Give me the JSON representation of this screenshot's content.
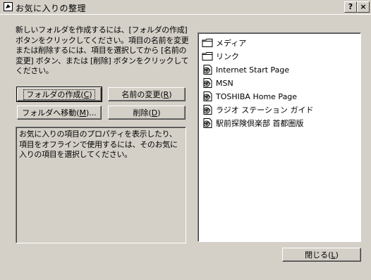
{
  "window": {
    "title": "お気に入りの整理",
    "help_label": "?",
    "close_label": "×"
  },
  "description": "新しいフォルダを作成するには、[フォルダの作成] ボタンをクリックしてください。項目の名前を変更または削除するには、項目を選択してから [名前の変更] ボタン、または [削除] ボタンをクリックしてください。",
  "buttons": {
    "create_folder": {
      "text": "フォルダの作成(",
      "key": "C",
      "end": ")"
    },
    "rename": {
      "text": "名前の変更(",
      "key": "R",
      "end": ")"
    },
    "move_to_folder": {
      "text": "フォルダへ移動(",
      "key": "M",
      "end": ")..."
    },
    "delete": {
      "text": "削除(",
      "key": "D",
      "end": ")"
    },
    "close": {
      "text": "閉じる(",
      "key": "L",
      "end": ")"
    }
  },
  "info_text": "お気に入りの項目のプロパティを表示したり、項目をオフラインで使用するには、そのお気に入りの項目を選択してください。",
  "favorites": [
    {
      "label": "メディア",
      "icon": "folder-icon"
    },
    {
      "label": "リンク",
      "icon": "folder-icon"
    },
    {
      "label": "Internet Start Page",
      "icon": "ie-page-icon"
    },
    {
      "label": "MSN",
      "icon": "ie-page-icon"
    },
    {
      "label": "TOSHIBA Home Page",
      "icon": "ie-page-icon"
    },
    {
      "label": "ラジオ ステーション ガイド",
      "icon": "ie-page-icon"
    },
    {
      "label": "駅前探険倶楽部 首都圏版",
      "icon": "ie-page-icon"
    }
  ]
}
